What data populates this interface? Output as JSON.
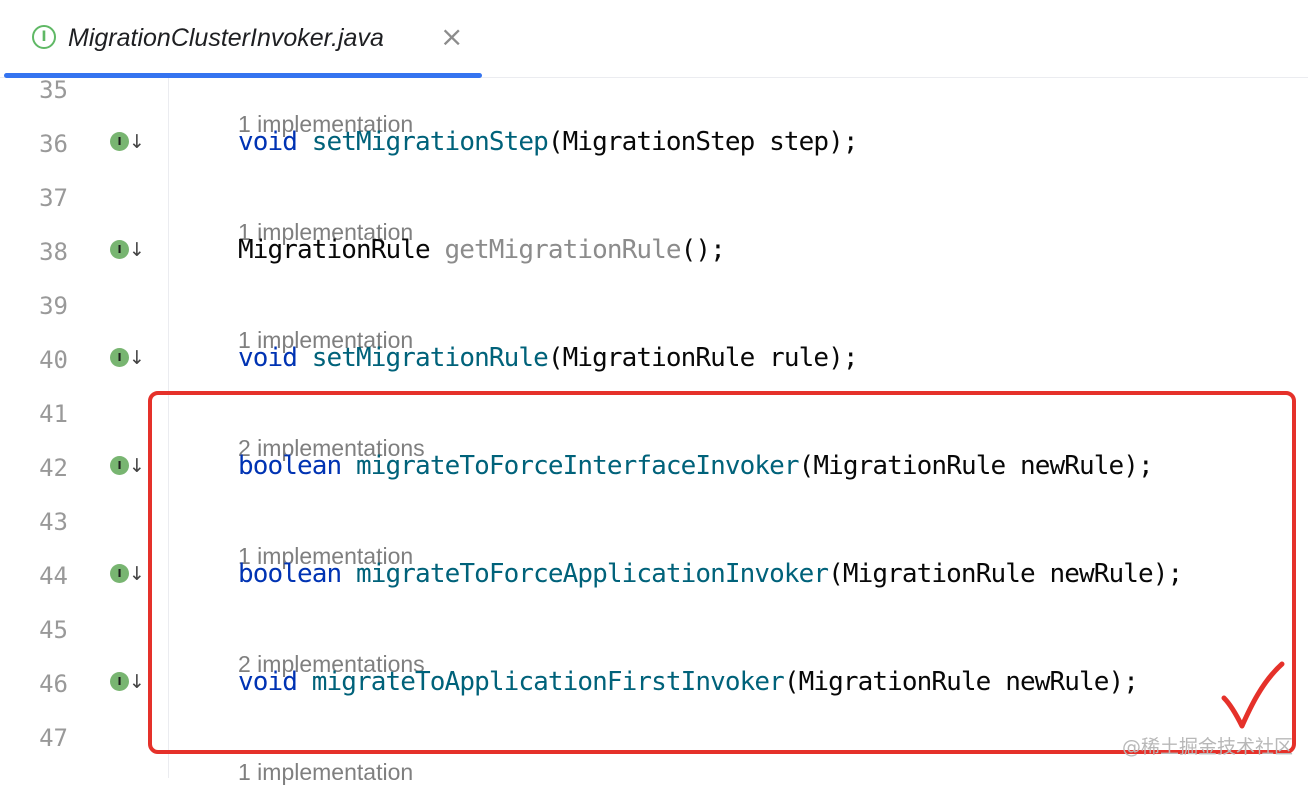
{
  "tab": {
    "icon_letter": "I",
    "title": "MigrationClusterInvoker.java",
    "close_glyph": "×"
  },
  "editor": {
    "lines": [
      {
        "number": "35",
        "hint": "1 implementation"
      },
      {
        "number": "36",
        "tokens": [
          {
            "text": "void",
            "kind": "kw"
          },
          {
            "text": " "
          },
          {
            "text": "setMigrationStep",
            "kind": "fn"
          },
          {
            "text": "(MigrationStep step);"
          }
        ],
        "gutter_icon": "implemented-interface-icon"
      },
      {
        "number": "37",
        "hint": "1 implementation"
      },
      {
        "number": "38",
        "tokens": [
          {
            "text": "MigrationRule "
          },
          {
            "text": "getMigrationRule",
            "kind": "unused"
          },
          {
            "text": "();"
          }
        ],
        "gutter_icon": "implemented-interface-icon"
      },
      {
        "number": "39",
        "hint": "1 implementation"
      },
      {
        "number": "40",
        "tokens": [
          {
            "text": "void",
            "kind": "kw"
          },
          {
            "text": " "
          },
          {
            "text": "setMigrationRule",
            "kind": "fn"
          },
          {
            "text": "(MigrationRule rule);"
          }
        ],
        "gutter_icon": "implemented-interface-icon"
      },
      {
        "number": "41",
        "hint": "2 implementations"
      },
      {
        "number": "42",
        "tokens": [
          {
            "text": "boolean",
            "kind": "kw"
          },
          {
            "text": " "
          },
          {
            "text": "migrateToForceInterfaceInvoker",
            "kind": "fn"
          },
          {
            "text": "(MigrationRule newRule);"
          }
        ],
        "gutter_icon": "implemented-interface-icon"
      },
      {
        "number": "43",
        "hint": "1 implementation"
      },
      {
        "number": "44",
        "tokens": [
          {
            "text": "boolean",
            "kind": "kw"
          },
          {
            "text": " "
          },
          {
            "text": "migrateToForceApplicationInvoker",
            "kind": "fn"
          },
          {
            "text": "(MigrationRule newRule);"
          }
        ],
        "gutter_icon": "implemented-interface-icon"
      },
      {
        "number": "45",
        "hint": "2 implementations"
      },
      {
        "number": "46",
        "tokens": [
          {
            "text": "void",
            "kind": "kw"
          },
          {
            "text": " "
          },
          {
            "text": "migrateToApplicationFirstInvoker",
            "kind": "fn"
          },
          {
            "text": "(MigrationRule newRule);"
          }
        ],
        "gutter_icon": "implemented-interface-icon"
      },
      {
        "number": "47",
        "hint": "1 implementation"
      }
    ],
    "gutter_icon_letter": "I",
    "gutter_arrow_glyph": "↓"
  },
  "annotation": {
    "color": "#e5312a",
    "checkmark": "check-mark"
  },
  "watermark": "@稀土掘金技术社区",
  "colors": {
    "keyword": "#0033b3",
    "method": "#00627a",
    "unused": "#8c8c8c",
    "hint": "#7f7f7f",
    "line_number": "#999999",
    "tab_accent": "#3574f0"
  }
}
